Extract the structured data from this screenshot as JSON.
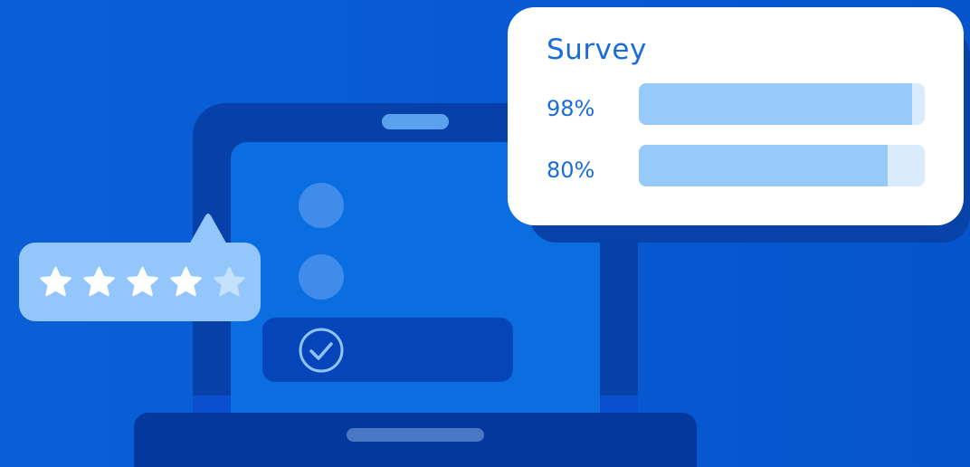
{
  "survey": {
    "title": "Survey",
    "rows": [
      {
        "label": "98%",
        "value": 0.955
      },
      {
        "label": "80%",
        "value": 0.87
      }
    ]
  },
  "rating": {
    "filled": 4,
    "total": 5
  },
  "colors": {
    "background": "#075ad3",
    "accent_text": "#1a6cd8",
    "bar_fill": "#95cafb",
    "bar_track": "#d9ebfd",
    "star_filled": "#ffffff",
    "star_empty": "#c5e1fd"
  },
  "icons": {
    "check": "check-circle-icon",
    "star": "star-icon"
  }
}
